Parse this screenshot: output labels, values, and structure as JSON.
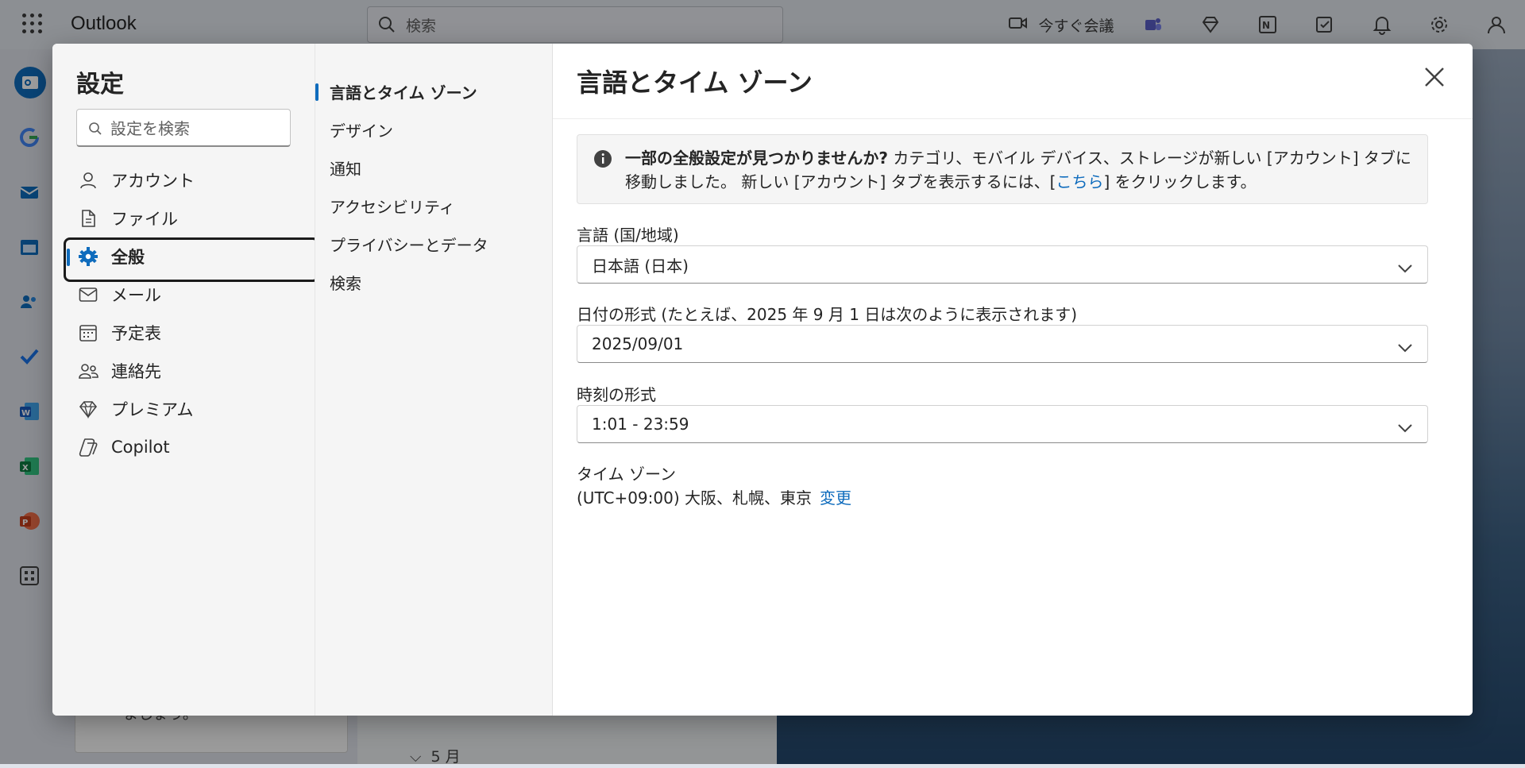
{
  "app": {
    "name": "Outlook",
    "search_placeholder": "検索",
    "meet_now": "今すぐ会議"
  },
  "background": {
    "card_text": "ましょう。",
    "month": "5 月"
  },
  "settings": {
    "title": "設定",
    "search_placeholder": "設定を検索",
    "categories": [
      {
        "label": "アカウント",
        "icon": "person-icon"
      },
      {
        "label": "ファイル",
        "icon": "document-icon"
      },
      {
        "label": "全般",
        "icon": "gear-icon"
      },
      {
        "label": "メール",
        "icon": "mail-icon"
      },
      {
        "label": "予定表",
        "icon": "calendar-icon"
      },
      {
        "label": "連絡先",
        "icon": "people-icon"
      },
      {
        "label": "プレミアム",
        "icon": "diamond-icon"
      },
      {
        "label": "Copilot",
        "icon": "copilot-icon"
      }
    ],
    "subcategories": [
      {
        "label": "言語とタイム ゾーン"
      },
      {
        "label": "デザイン"
      },
      {
        "label": "通知"
      },
      {
        "label": "アクセシビリティ"
      },
      {
        "label": "プライバシーとデータ"
      },
      {
        "label": "検索"
      }
    ],
    "main": {
      "title": "言語とタイム ゾーン",
      "info_bold": "一部の全般設定が見つかりませんか?",
      "info_text1": " カテゴリ、モバイル デバイス、ストレージが新しい [アカウント] タブに移動しました。 新しい [アカウント] タブを表示するには、[",
      "info_link": "こちら",
      "info_text2": "] をクリックします。",
      "language_label": "言語 (国/地域)",
      "language_value": "日本語 (日本)",
      "date_label": "日付の形式 (たとえば、2025 年 9 月 1 日は次のように表示されます)",
      "date_value": "2025/09/01",
      "time_label": "時刻の形式",
      "time_value": "1:01 - 23:59",
      "tz_label": "タイム ゾーン",
      "tz_value": "(UTC+09:00) 大阪、札幌、東京",
      "tz_change": "変更"
    }
  }
}
